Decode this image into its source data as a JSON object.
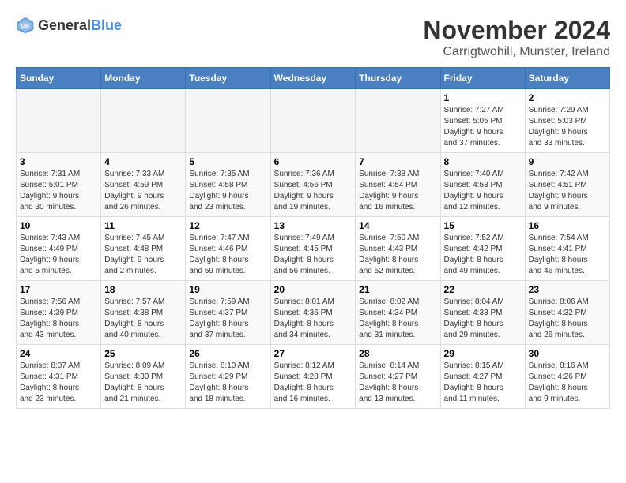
{
  "header": {
    "logo_general": "General",
    "logo_blue": "Blue",
    "month_title": "November 2024",
    "location": "Carrigtwohill, Munster, Ireland"
  },
  "weekdays": [
    "Sunday",
    "Monday",
    "Tuesday",
    "Wednesday",
    "Thursday",
    "Friday",
    "Saturday"
  ],
  "weeks": [
    [
      {
        "day": "",
        "info": ""
      },
      {
        "day": "",
        "info": ""
      },
      {
        "day": "",
        "info": ""
      },
      {
        "day": "",
        "info": ""
      },
      {
        "day": "",
        "info": ""
      },
      {
        "day": "1",
        "info": "Sunrise: 7:27 AM\nSunset: 5:05 PM\nDaylight: 9 hours\nand 37 minutes."
      },
      {
        "day": "2",
        "info": "Sunrise: 7:29 AM\nSunset: 5:03 PM\nDaylight: 9 hours\nand 33 minutes."
      }
    ],
    [
      {
        "day": "3",
        "info": "Sunrise: 7:31 AM\nSunset: 5:01 PM\nDaylight: 9 hours\nand 30 minutes."
      },
      {
        "day": "4",
        "info": "Sunrise: 7:33 AM\nSunset: 4:59 PM\nDaylight: 9 hours\nand 26 minutes."
      },
      {
        "day": "5",
        "info": "Sunrise: 7:35 AM\nSunset: 4:58 PM\nDaylight: 9 hours\nand 23 minutes."
      },
      {
        "day": "6",
        "info": "Sunrise: 7:36 AM\nSunset: 4:56 PM\nDaylight: 9 hours\nand 19 minutes."
      },
      {
        "day": "7",
        "info": "Sunrise: 7:38 AM\nSunset: 4:54 PM\nDaylight: 9 hours\nand 16 minutes."
      },
      {
        "day": "8",
        "info": "Sunrise: 7:40 AM\nSunset: 4:53 PM\nDaylight: 9 hours\nand 12 minutes."
      },
      {
        "day": "9",
        "info": "Sunrise: 7:42 AM\nSunset: 4:51 PM\nDaylight: 9 hours\nand 9 minutes."
      }
    ],
    [
      {
        "day": "10",
        "info": "Sunrise: 7:43 AM\nSunset: 4:49 PM\nDaylight: 9 hours\nand 5 minutes."
      },
      {
        "day": "11",
        "info": "Sunrise: 7:45 AM\nSunset: 4:48 PM\nDaylight: 9 hours\nand 2 minutes."
      },
      {
        "day": "12",
        "info": "Sunrise: 7:47 AM\nSunset: 4:46 PM\nDaylight: 8 hours\nand 59 minutes."
      },
      {
        "day": "13",
        "info": "Sunrise: 7:49 AM\nSunset: 4:45 PM\nDaylight: 8 hours\nand 56 minutes."
      },
      {
        "day": "14",
        "info": "Sunrise: 7:50 AM\nSunset: 4:43 PM\nDaylight: 8 hours\nand 52 minutes."
      },
      {
        "day": "15",
        "info": "Sunrise: 7:52 AM\nSunset: 4:42 PM\nDaylight: 8 hours\nand 49 minutes."
      },
      {
        "day": "16",
        "info": "Sunrise: 7:54 AM\nSunset: 4:41 PM\nDaylight: 8 hours\nand 46 minutes."
      }
    ],
    [
      {
        "day": "17",
        "info": "Sunrise: 7:56 AM\nSunset: 4:39 PM\nDaylight: 8 hours\nand 43 minutes."
      },
      {
        "day": "18",
        "info": "Sunrise: 7:57 AM\nSunset: 4:38 PM\nDaylight: 8 hours\nand 40 minutes."
      },
      {
        "day": "19",
        "info": "Sunrise: 7:59 AM\nSunset: 4:37 PM\nDaylight: 8 hours\nand 37 minutes."
      },
      {
        "day": "20",
        "info": "Sunrise: 8:01 AM\nSunset: 4:36 PM\nDaylight: 8 hours\nand 34 minutes."
      },
      {
        "day": "21",
        "info": "Sunrise: 8:02 AM\nSunset: 4:34 PM\nDaylight: 8 hours\nand 31 minutes."
      },
      {
        "day": "22",
        "info": "Sunrise: 8:04 AM\nSunset: 4:33 PM\nDaylight: 8 hours\nand 29 minutes."
      },
      {
        "day": "23",
        "info": "Sunrise: 8:06 AM\nSunset: 4:32 PM\nDaylight: 8 hours\nand 26 minutes."
      }
    ],
    [
      {
        "day": "24",
        "info": "Sunrise: 8:07 AM\nSunset: 4:31 PM\nDaylight: 8 hours\nand 23 minutes."
      },
      {
        "day": "25",
        "info": "Sunrise: 8:09 AM\nSunset: 4:30 PM\nDaylight: 8 hours\nand 21 minutes."
      },
      {
        "day": "26",
        "info": "Sunrise: 8:10 AM\nSunset: 4:29 PM\nDaylight: 8 hours\nand 18 minutes."
      },
      {
        "day": "27",
        "info": "Sunrise: 8:12 AM\nSunset: 4:28 PM\nDaylight: 8 hours\nand 16 minutes."
      },
      {
        "day": "28",
        "info": "Sunrise: 8:14 AM\nSunset: 4:27 PM\nDaylight: 8 hours\nand 13 minutes."
      },
      {
        "day": "29",
        "info": "Sunrise: 8:15 AM\nSunset: 4:27 PM\nDaylight: 8 hours\nand 11 minutes."
      },
      {
        "day": "30",
        "info": "Sunrise: 8:16 AM\nSunset: 4:26 PM\nDaylight: 8 hours\nand 9 minutes."
      }
    ]
  ]
}
